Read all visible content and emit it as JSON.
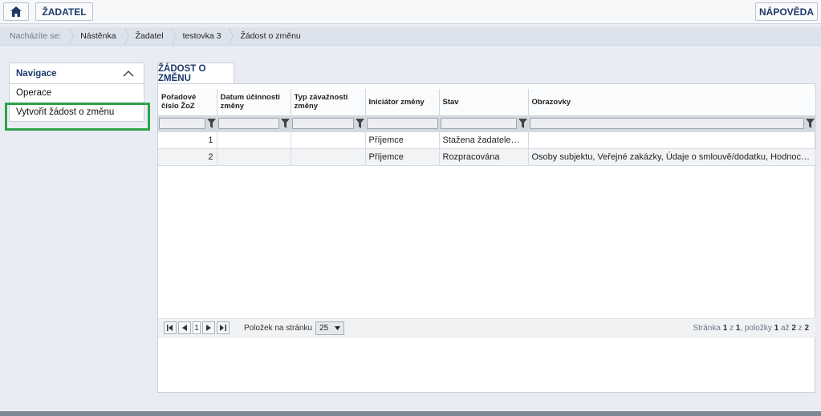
{
  "header": {
    "zadatel_label": "ŽADATEL",
    "help_label": "NÁPOVĚDA"
  },
  "breadcrumb": {
    "prefix": "Nacházíte se:",
    "items": [
      "Nástěnka",
      "Žadatel",
      "testovka 3",
      "Žádost o změnu"
    ]
  },
  "nav": {
    "title": "Navigace",
    "items": [
      "Operace",
      "Vytvořit žádost o změnu"
    ]
  },
  "tab": {
    "label": "ŽÁDOST O ZMĚNU"
  },
  "table": {
    "columns": [
      "Pořadové číslo ŽoZ",
      "Datum účinnosti změny",
      "Typ závažnosti změny",
      "Iniciátor změny",
      "Stav",
      "Obrazovky"
    ],
    "rows": [
      [
        "1",
        "",
        "",
        "Příjemce",
        "Stažena žadatelem/p...",
        ""
      ],
      [
        "2",
        "",
        "",
        "Příjemce",
        "Rozpracována",
        "Osoby subjektu, Veřejné zakázky, Údaje o smlouvě/dodatku, Hodnocení a odvolán..."
      ]
    ]
  },
  "pager": {
    "current_page": "1",
    "per_page_label": "Položek na stránku",
    "per_page_value": "25",
    "info_prefix": "Stránka ",
    "page": "1",
    "of": " z ",
    "pages": "1",
    "items_label": ", položky ",
    "from": "1",
    "to_label": " až ",
    "to": "2",
    "total_label": " z ",
    "total": "2"
  },
  "colors": {
    "accent": "#1b3a6b",
    "highlight": "#2ea34a"
  }
}
